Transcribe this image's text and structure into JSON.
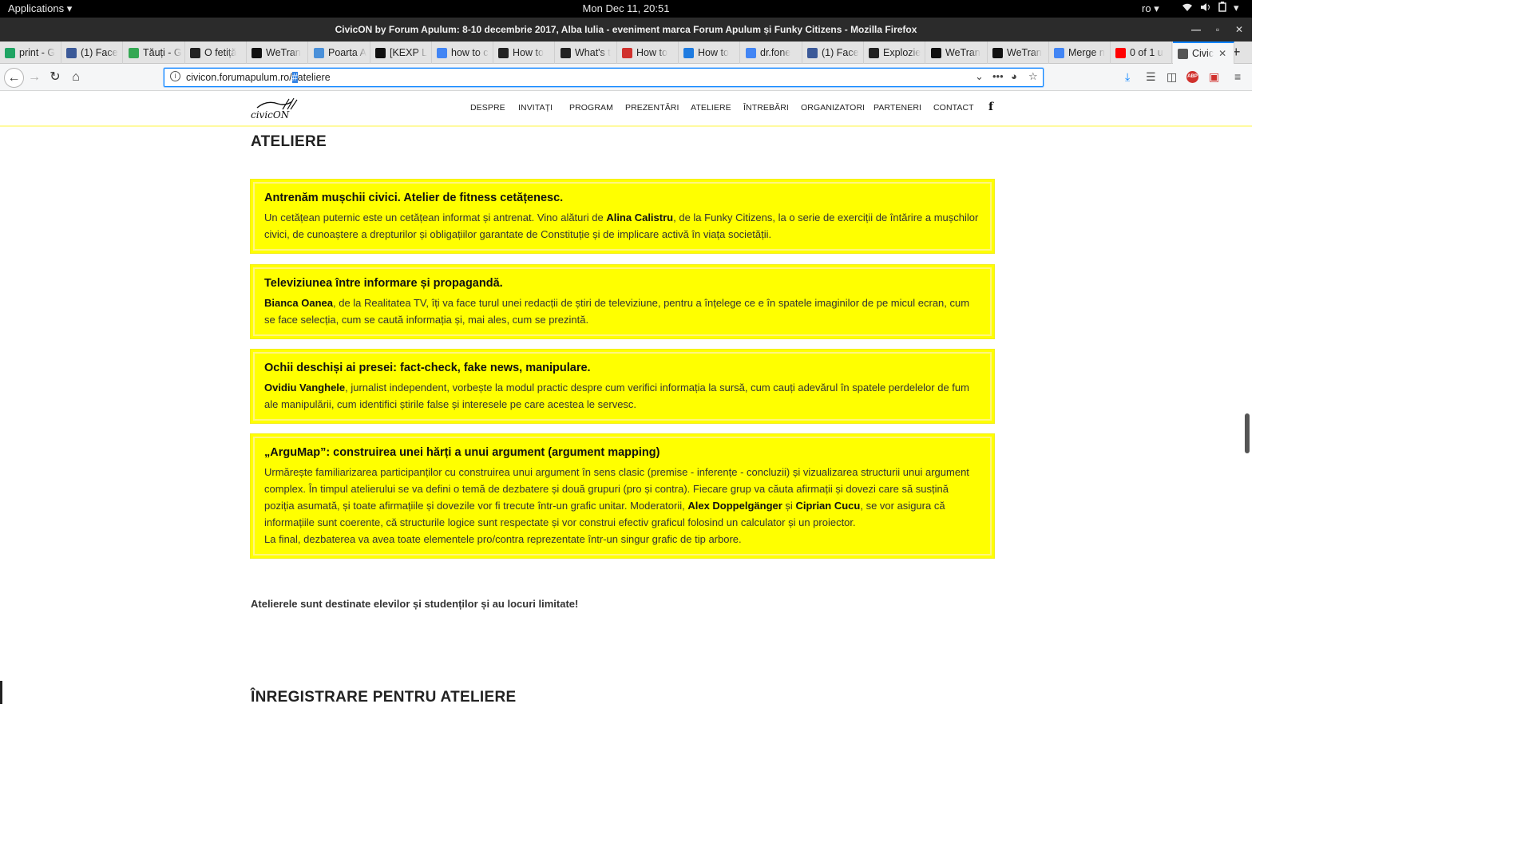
{
  "desktop": {
    "applications_label": "Applications",
    "clock": "Mon Dec 11, 20:51",
    "language": "ro"
  },
  "window": {
    "title": "CivicON by Forum Apulum: 8-10 decembrie 2017, Alba Iulia - eveniment marca Forum Apulum și Funky Citizens - Mozilla Firefox"
  },
  "tabs": [
    {
      "label": "print - G",
      "icon": "google-drive-icon",
      "color": "#1fa463"
    },
    {
      "label": "(1) Face",
      "icon": "facebook-icon",
      "color": "#3b5998"
    },
    {
      "label": "Tăuți - G",
      "icon": "google-maps-icon",
      "color": "#34a853"
    },
    {
      "label": "O fetiță",
      "icon": "news-site-icon",
      "color": "#222222"
    },
    {
      "label": "WeTran",
      "icon": "wetransfer-icon",
      "color": "#111111"
    },
    {
      "label": "Poarta A",
      "icon": "image-icon",
      "color": "#4a90d9"
    },
    {
      "label": "[KEXP L",
      "icon": "kexp-icon",
      "color": "#111111"
    },
    {
      "label": "how to c",
      "icon": "google-icon",
      "color": "#4285f4"
    },
    {
      "label": "How to",
      "icon": "htg-icon",
      "color": "#222222"
    },
    {
      "label": "What's t",
      "icon": "htg-icon",
      "color": "#222222"
    },
    {
      "label": "How to",
      "icon": "site-icon",
      "color": "#d0312d"
    },
    {
      "label": "How to",
      "icon": "plus-site-icon",
      "color": "#1e7be0"
    },
    {
      "label": "dr.fone",
      "icon": "google-icon",
      "color": "#4285f4"
    },
    {
      "label": "(1) Face",
      "icon": "facebook-icon",
      "color": "#3b5998"
    },
    {
      "label": "Explozie",
      "icon": "news-site-icon",
      "color": "#222222"
    },
    {
      "label": "WeTran",
      "icon": "wetransfer-icon",
      "color": "#111111"
    },
    {
      "label": "WeTran",
      "icon": "wetransfer-icon",
      "color": "#111111"
    },
    {
      "label": "Merge n",
      "icon": "google-icon",
      "color": "#4285f4"
    },
    {
      "label": "0 of 1 u",
      "icon": "youtube-icon",
      "color": "#ff0000"
    },
    {
      "label": "Civic",
      "icon": "civicon-icon",
      "color": "#555555"
    }
  ],
  "urlbar": {
    "url_prefix": "civicon.forumapulum.ro/",
    "url_selected": "#",
    "url_suffix": "ateliere"
  },
  "site": {
    "logo_text": "civicON",
    "nav": [
      "DESPRE",
      "INVITAȚI",
      "PROGRAM",
      "PREZENTĂRI",
      "ATELIERE",
      "ÎNTREBĂRI",
      "ORGANIZATORI",
      "PARTENERI",
      "CONTACT"
    ],
    "facebook": "f"
  },
  "section_title": "ATELIERE",
  "workshops": [
    {
      "title": "Antrenăm mușchii civici. Atelier de fitness cetățenesc.",
      "body": [
        {
          "t": "Un cetățean puternic este un cetățean informat și antrenat. Vino alături de "
        },
        {
          "t": "Alina Calistru",
          "b": true
        },
        {
          "t": ", de la Funky Citizens, la o serie de exerciții de întărire a mușchilor civici, de cunoaștere a drepturilor și obligațiilor garantate de Constituție și de implicare activă în viața societății."
        }
      ]
    },
    {
      "title": "Televiziunea între informare și propagandă.",
      "body": [
        {
          "t": "Bianca Oanea",
          "b": true
        },
        {
          "t": ", de la Realitatea TV, îți va face turul unei redacții de știri de televiziune, pentru a înțelege ce e în spatele imaginilor de pe micul ecran, cum se face selecția, cum se caută informația și, mai ales, cum se prezintă."
        }
      ]
    },
    {
      "title": "Ochii deschiși ai presei: fact-check, fake news, manipulare.",
      "body": [
        {
          "t": "Ovidiu Vanghele",
          "b": true
        },
        {
          "t": ", jurnalist independent, vorbește la modul practic despre cum verifici informația la sursă, cum cauți adevărul în spatele perdelelor de fum ale manipulării, cum identifici știrile false și interesele pe care acestea le servesc."
        }
      ]
    },
    {
      "title": "„ArguMap”: construirea unei hărți a unui argument (argument mapping)",
      "body": [
        {
          "t": "Urmărește familiarizarea participanților cu construirea unui argument în sens clasic (premise - inferențe - concluzii) și vizualizarea structurii unui argument complex. În timpul atelierului se va defini o temă de dezbatere și două grupuri (pro și contra). Fiecare grup va căuta afirmații și dovezi care să susțină poziția asumată, și toate afirmațiile și dovezile vor fi trecute într-un grafic unitar. Moderatorii, "
        },
        {
          "t": "Alex Doppelgänger",
          "b": true
        },
        {
          "t": " și "
        },
        {
          "t": "Ciprian Cucu",
          "b": true
        },
        {
          "t": ", se vor asigura că informațiile sunt coerente, că structurile logice sunt respectate și vor construi efectiv graficul folosind un calculator și un proiector."
        },
        {
          "br": true
        },
        {
          "t": "La final, dezbaterea va avea toate elementele pro/contra reprezentate într-un singur grafic de tip arbore."
        }
      ]
    }
  ],
  "note": "Atelierele sunt destinate elevilor și studenților și au locuri limitate!",
  "registration_title": "ÎNREGISTRARE PENTRU ATELIERE"
}
